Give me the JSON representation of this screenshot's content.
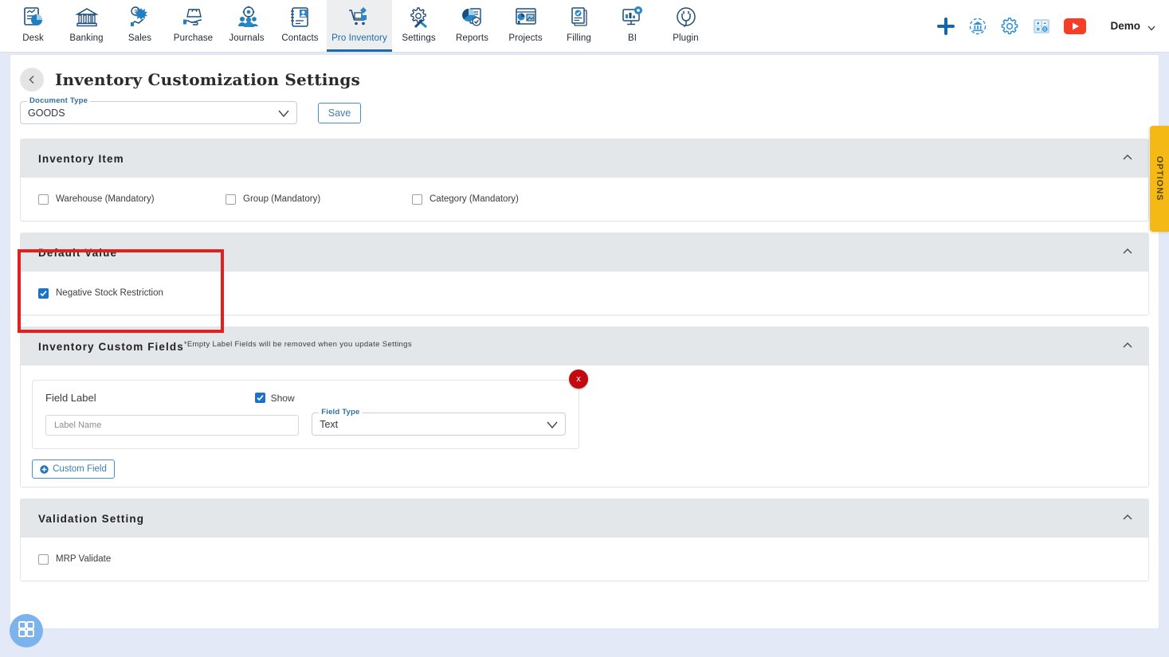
{
  "topnav": {
    "items": [
      {
        "label": "Desk",
        "icon": "dashboard-icon",
        "active": false
      },
      {
        "label": "Banking",
        "icon": "bank-icon",
        "active": false
      },
      {
        "label": "Sales",
        "icon": "sales-icon",
        "active": false
      },
      {
        "label": "Purchase",
        "icon": "purchase-icon",
        "active": false
      },
      {
        "label": "Journals",
        "icon": "journals-icon",
        "active": false
      },
      {
        "label": "Contacts",
        "icon": "contacts-icon",
        "active": false
      },
      {
        "label": "Pro Inventory",
        "icon": "pro-inventory-icon",
        "active": true
      },
      {
        "label": "Settings",
        "icon": "settings-icon",
        "active": false
      },
      {
        "label": "Reports",
        "icon": "reports-icon",
        "active": false
      },
      {
        "label": "Projects",
        "icon": "projects-icon",
        "active": false
      },
      {
        "label": "Filling",
        "icon": "filling-icon",
        "active": false
      },
      {
        "label": "BI",
        "icon": "bi-icon",
        "active": false
      },
      {
        "label": "Plugin",
        "icon": "plugin-icon",
        "active": false
      }
    ],
    "right_icons": [
      {
        "name": "add-plus-icon",
        "color": "#1267b2"
      },
      {
        "name": "bank-sync-icon",
        "color": "#2f8fd8"
      },
      {
        "name": "gear-icon",
        "color": "#2f8fd8"
      },
      {
        "name": "calculator-icon",
        "color": "#2f8fd8"
      },
      {
        "name": "youtube-icon",
        "color": "#f73d27"
      }
    ],
    "user": {
      "name": "Demo"
    }
  },
  "header": {
    "back_label": "‹",
    "title": "Inventory Customization Settings"
  },
  "doc_type": {
    "label": "Document Type",
    "value": "GOODS",
    "options": [
      "GOODS"
    ],
    "save_label": "Save"
  },
  "panels": {
    "inventory_item": {
      "title": "Inventory Item",
      "checkboxes": [
        {
          "label": "Warehouse (Mandatory)",
          "checked": false
        },
        {
          "label": "Group (Mandatory)",
          "checked": false
        },
        {
          "label": "Category (Mandatory)",
          "checked": false
        }
      ]
    },
    "default_value": {
      "title": "Default Value",
      "checkboxes": [
        {
          "label": "Negative Stock Restriction",
          "checked": true
        }
      ]
    },
    "custom_fields": {
      "title": "Inventory Custom Fields",
      "note": "*Empty Label Fields will be removed when you update Settings",
      "field_label_title": "Field Label",
      "show_label": "Show",
      "show_checked": true,
      "label_input_placeholder": "Label Name",
      "label_input_value": "",
      "field_type_label": "Field Type",
      "field_type_value": "Text",
      "field_type_options": [
        "Text"
      ],
      "remove_label": "x",
      "add_button_label": "Custom Field"
    },
    "validation_setting": {
      "title": "Validation Setting",
      "checkboxes": [
        {
          "label": "MRP Validate",
          "checked": false
        }
      ]
    }
  },
  "options_tab": {
    "label": "OPTIONS",
    "color": "#f5b916"
  },
  "fab": {
    "icon": "grid-apps-icon",
    "color": "#7cb3ec"
  },
  "colors": {
    "accent_blue": "#1b6ca8",
    "checkbox_blue": "#1a73c8",
    "highlight_red": "#e32020",
    "remove_red": "#c10b10",
    "panel_header": "#e4e7ea",
    "page_bg": "#e3e9f7"
  }
}
